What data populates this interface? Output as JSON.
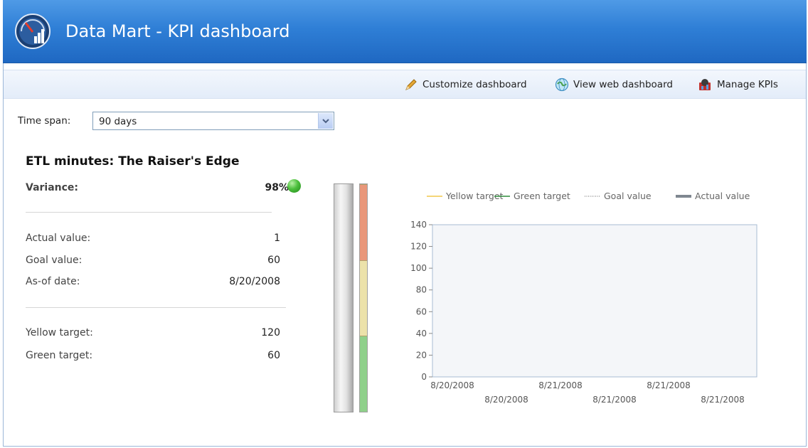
{
  "app": {
    "title": "Data Mart - KPI dashboard",
    "icon": "gauge-chart-icon"
  },
  "toolbar": {
    "actions": [
      {
        "label": "Customize dashboard",
        "icon": "pencil-icon"
      },
      {
        "label": "View web dashboard",
        "icon": "globe-icon"
      },
      {
        "label": "Manage KPIs",
        "icon": "kpi-gear-icon"
      }
    ]
  },
  "filters": {
    "time_span_label": "Time span:",
    "time_span_value": "90 days"
  },
  "kpi": {
    "title": "ETL minutes: The Raiser's Edge",
    "variance_label": "Variance:",
    "variance_value": "98%",
    "status_color": "#3cb232",
    "rows": [
      {
        "label": "Actual value:",
        "value": "1"
      },
      {
        "label": "Goal value:",
        "value": "60"
      },
      {
        "label": "As-of date:",
        "value": "8/20/2008"
      }
    ],
    "targets": [
      {
        "label": "Yellow target:",
        "value": "120"
      },
      {
        "label": "Green target:",
        "value": "60"
      }
    ]
  },
  "gauge": {
    "bands": [
      {
        "name": "red",
        "color": "#e9977a",
        "from": 120,
        "to": 180
      },
      {
        "name": "yellow",
        "color": "#ece2aa",
        "from": 60,
        "to": 120
      },
      {
        "name": "green",
        "color": "#8fd08a",
        "from": 0,
        "to": 60
      }
    ],
    "min": 0,
    "max": 180
  },
  "chart_data": {
    "type": "line",
    "legend": [
      {
        "name": "Yellow target",
        "color": "#f2c94c",
        "style": "solid"
      },
      {
        "name": "Green target",
        "color": "#2e8b3a",
        "style": "solid"
      },
      {
        "name": "Goal value",
        "color": "#999999",
        "style": "dotted"
      },
      {
        "name": "Actual value",
        "color": "#7f8790",
        "style": "thick"
      }
    ],
    "legend_position": "top",
    "y_ticks": [
      0,
      20,
      40,
      60,
      80,
      100,
      120,
      140
    ],
    "ylim": [
      0,
      140
    ],
    "x_tick_labels": [
      "8/20/2008",
      "8/20/2008",
      "8/21/2008",
      "8/21/2008",
      "8/21/2008",
      "8/21/2008"
    ],
    "series": []
  }
}
